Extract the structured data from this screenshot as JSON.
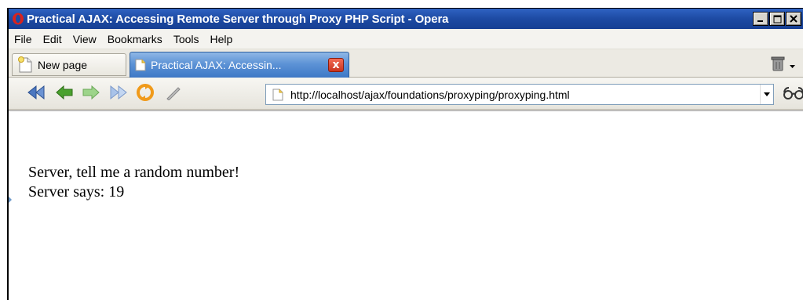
{
  "window": {
    "title": "Practical AJAX: Accessing Remote Server through Proxy PHP Script - Opera",
    "buttons": {
      "minimize": "_",
      "maximize": "□",
      "close": "×"
    }
  },
  "menu": {
    "items": [
      "File",
      "Edit",
      "View",
      "Bookmarks",
      "Tools",
      "Help"
    ]
  },
  "tabs": {
    "new_page_label": "New page",
    "active_label": "Practical AJAX: Accessin...",
    "close_label": "x"
  },
  "toolbar": {
    "icons": [
      "rewind-icon",
      "back-icon",
      "forward-icon",
      "fast-forward-icon",
      "reload-icon",
      "edit-icon"
    ],
    "url": "http://localhost/ajax/foundations/proxyping/proxyping.html"
  },
  "page": {
    "line1": "Server, tell me a random number!",
    "line2": "Server says: 19"
  },
  "colors": {
    "titlebar": "#1d4aa3",
    "active_tab": "#5d93d6",
    "close_red": "#d6402a"
  }
}
